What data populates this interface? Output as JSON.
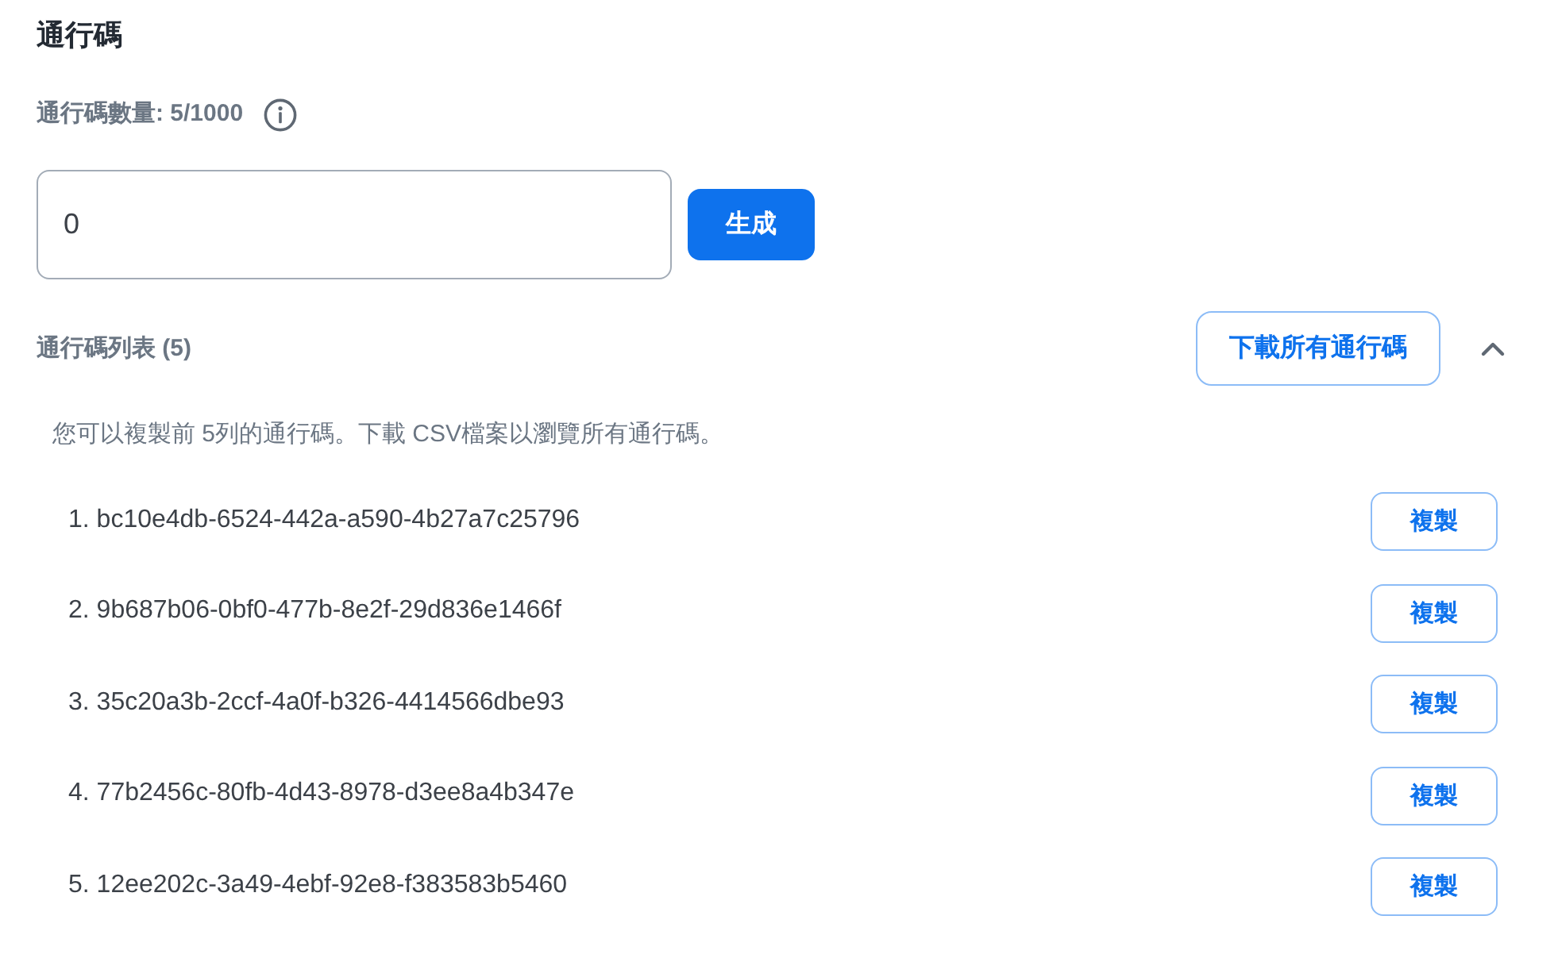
{
  "title": "通行碼",
  "quota": {
    "label": "通行碼數量: 5/1000"
  },
  "generator": {
    "value": "0",
    "button": "生成"
  },
  "list": {
    "title": "通行碼列表 (5)",
    "download_button": "下載所有通行碼",
    "expanded": true,
    "note": "您可以複製前 5列的通行碼。下載 CSV檔案以瀏覽所有通行碼。",
    "codes": [
      {
        "text": "1. bc10e4db-6524-442a-a590-4b27a7c25796",
        "button": "複製"
      },
      {
        "text": "2. 9b687b06-0bf0-477b-8e2f-29d836e1466f",
        "button": "複製"
      },
      {
        "text": "3. 35c20a3b-2ccf-4a0f-b326-4414566dbe93",
        "button": "複製"
      },
      {
        "text": "4. 77b2456c-80fb-4d43-8978-d3ee8a4b347e",
        "button": "複製"
      },
      {
        "text": "5. 12ee202c-3a49-4ebf-92e8-f383583b5460",
        "button": "複製"
      }
    ]
  }
}
